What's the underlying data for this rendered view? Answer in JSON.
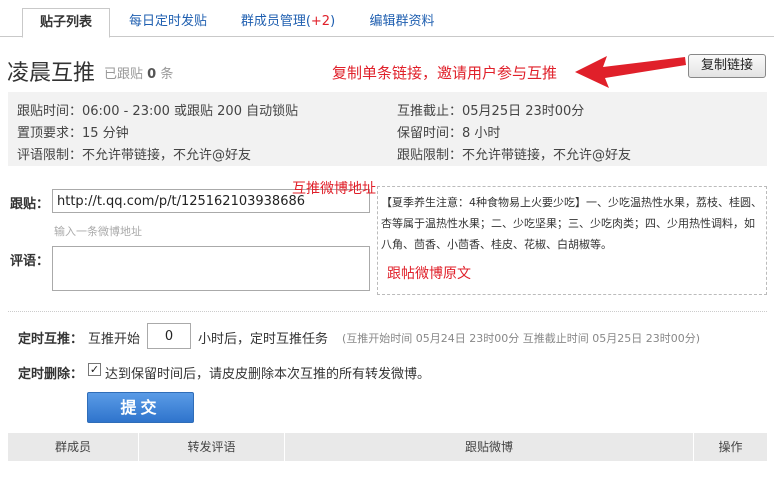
{
  "tabs": [
    {
      "label": "贴子列表"
    },
    {
      "label": "每日定时发贴"
    },
    {
      "label": "群成员管理(",
      "count": "+2",
      "suffix": ")"
    },
    {
      "label": "编辑群资料"
    }
  ],
  "header": {
    "title": "凌晨互推",
    "sub_prefix": "已跟贴",
    "sub_count": "0",
    "sub_suffix": "条",
    "copy_label": "复制链接",
    "annotation": "复制单条链接，邀请用户参与互推"
  },
  "info": {
    "follow_time": "跟贴时间：06:00 - 23:00 或跟贴 200 自动锁贴",
    "deadline": "互推截止：05月25日 23时00分",
    "pin_req": "置顶要求：15 分钟",
    "keep_time": "保留时间：8 小时",
    "comment_limit": "评语限制：不允许带链接，不允许@好友",
    "follow_limit": "跟贴限制：不允许带链接，不允许@好友"
  },
  "form": {
    "link_label": "跟贴：",
    "link_value": "http://t.qq.com/p/t/125162103938686",
    "link_annotation": "互推微博地址",
    "link_hint": "输入一条微博地址",
    "comment_label": "评语：",
    "preview_text": "【夏季养生注意：4种食物易上火要少吃】一、少吃温热性水果，荔枝、桂圆、杏等属于温热性水果；二、少吃坚果；三、少吃肉类；四、少用热性调料，如八角、茴香、小茴香、桂皮、花椒、白胡椒等。",
    "preview_annotation": "跟帖微博原文"
  },
  "timer": {
    "label": "定时互推：",
    "start_prefix": "互推开始",
    "hours_value": "0",
    "start_suffix": "小时后，定时互推任务",
    "detail": "(互推开始时间 05月24日 23时00分   互推截止时间 05月25日 23时00分)"
  },
  "auto_delete": {
    "label": "定时删除：",
    "checked": true,
    "check_mark": "✓",
    "text": "达到保留时间后，请皮皮删除本次互推的所有转发微博。"
  },
  "submit_label": "提交",
  "table": {
    "columns": [
      "群成员",
      "转发评语",
      "跟贴微博",
      "操作"
    ]
  },
  "colors": {
    "accent_red": "#e0202a",
    "link_blue": "#1f5fb0",
    "submit_blue": "#2f74cc"
  }
}
